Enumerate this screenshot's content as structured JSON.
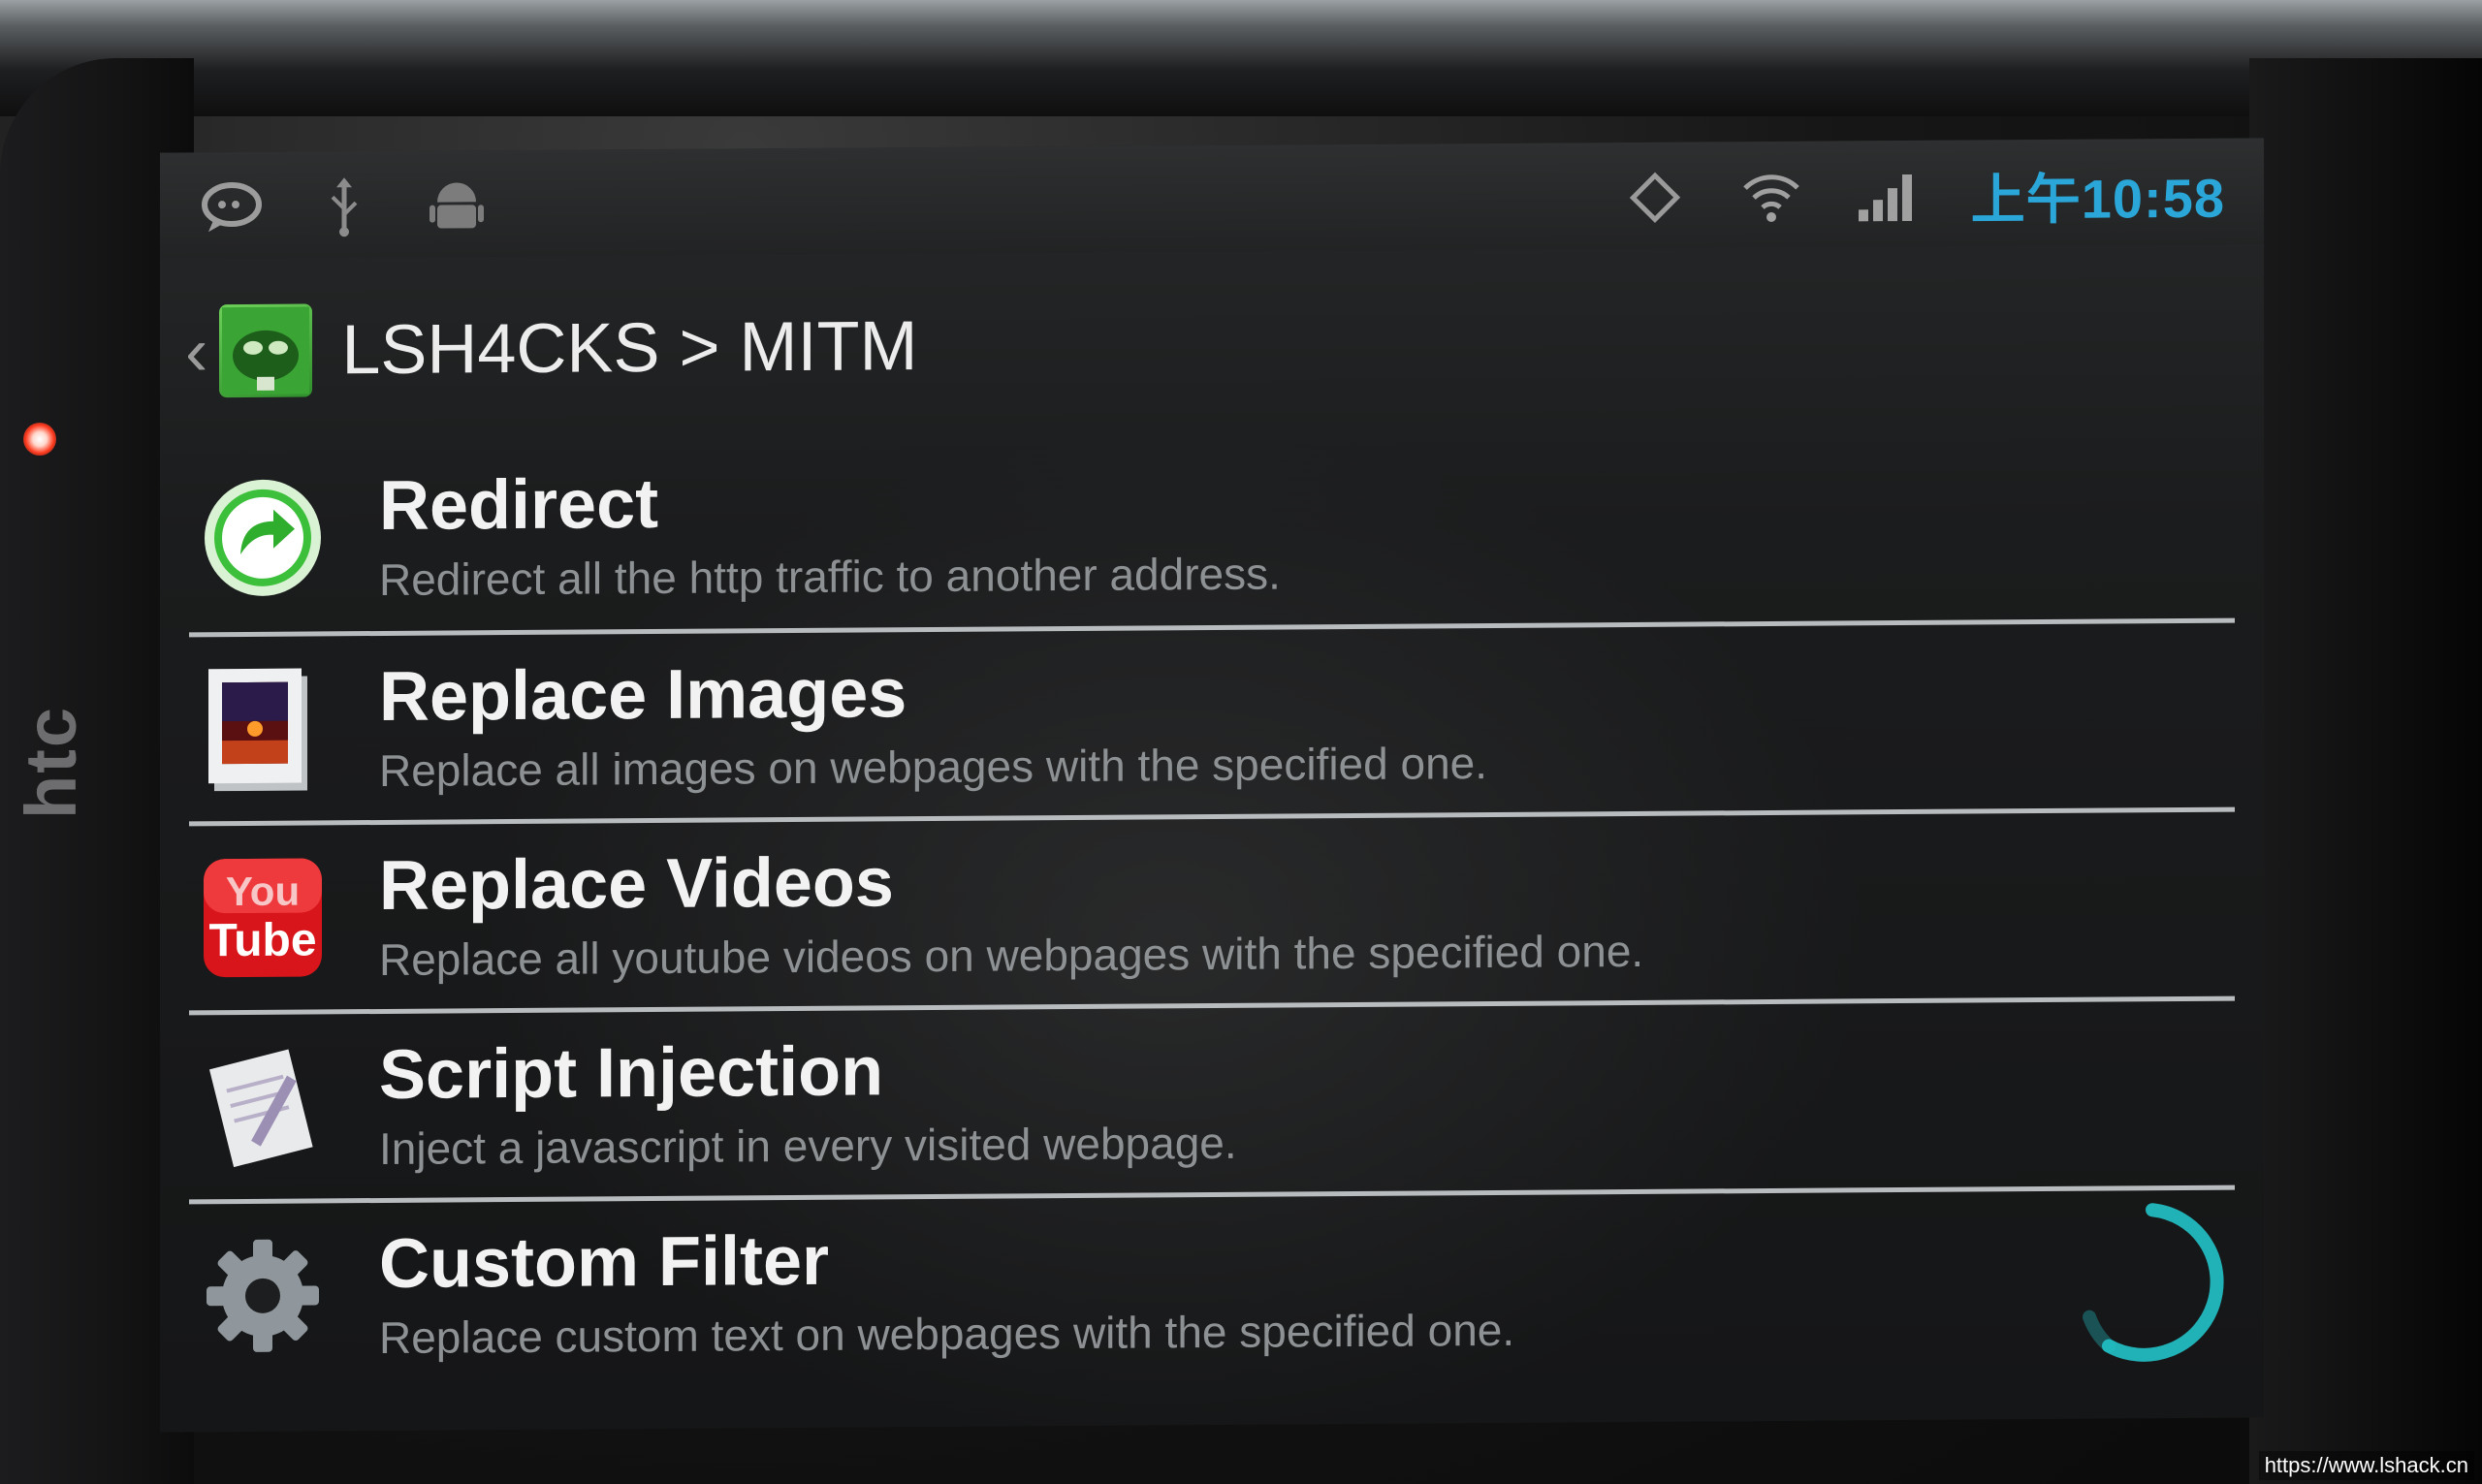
{
  "status_bar": {
    "left_icons": [
      "chat-icon",
      "usb-icon",
      "android-icon"
    ],
    "right_icons": [
      "rotate-icon",
      "wifi-icon",
      "signal-icon"
    ],
    "clock": "上午10:58"
  },
  "action_bar": {
    "back_glyph": "‹",
    "title": "LSH4CKS > MITM"
  },
  "items": [
    {
      "title": "Redirect",
      "subtitle": "Redirect all the http traffic to another address.",
      "icon": "redirect-arrow-icon"
    },
    {
      "title": "Replace Images",
      "subtitle": "Replace all images on webpages with the specified one.",
      "icon": "image-file-icon"
    },
    {
      "title": "Replace Videos",
      "subtitle": "Replace all youtube videos on webpages with the specified one.",
      "icon": "youtube-icon",
      "icon_text_top": "You",
      "icon_text_bottom": "Tube"
    },
    {
      "title": "Script Injection",
      "subtitle": "Inject a javascript in every visited webpage.",
      "icon": "script-icon"
    },
    {
      "title": "Custom Filter",
      "subtitle": "Replace custom text on webpages with the specified one.",
      "icon": "gear-icon"
    }
  ],
  "device": {
    "brand": "htc"
  },
  "watermark": "https://www.lshack.cn",
  "colors": {
    "clock": "#2aa7d8",
    "spinner": "#22c3c9",
    "divider": "#b9bcbe"
  }
}
